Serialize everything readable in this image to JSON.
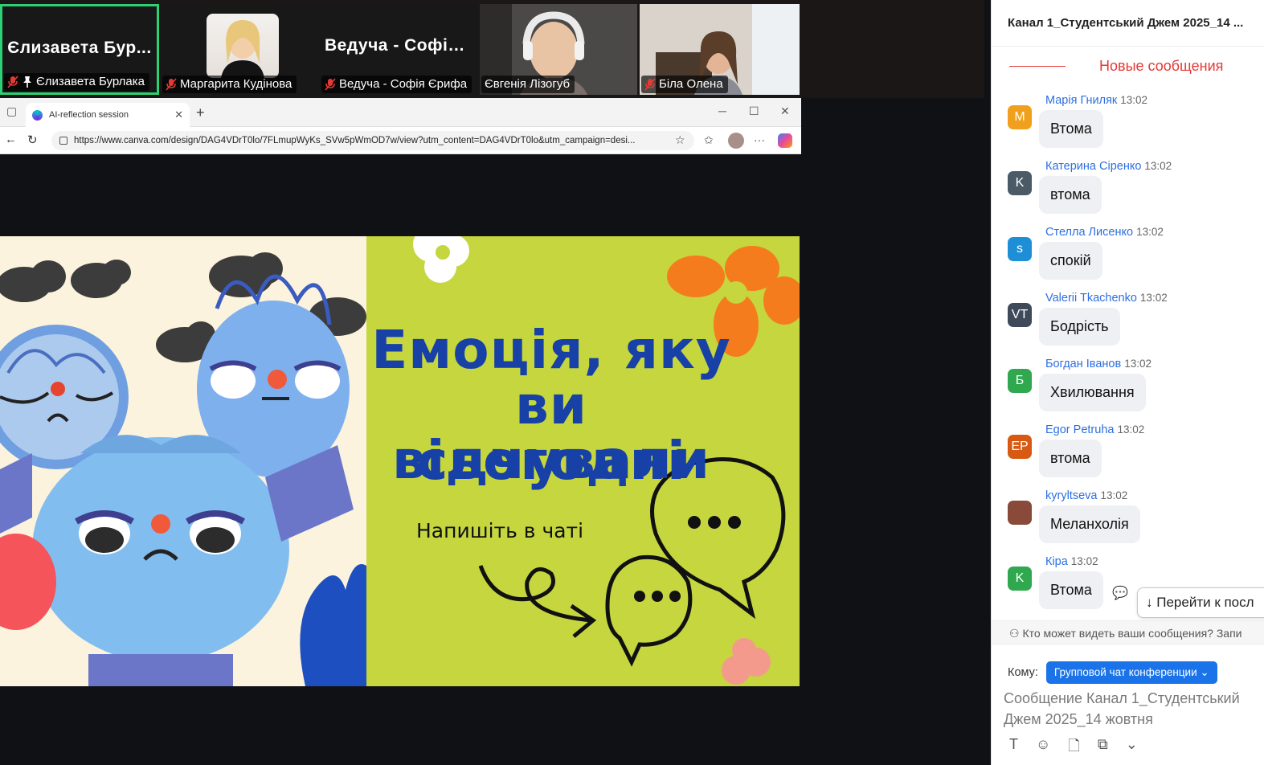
{
  "participants": [
    {
      "big_name": "Єлизавета  Бур...",
      "label": "Єлизавета Бурлака",
      "pinned": true,
      "active": true
    },
    {
      "big_name": "",
      "label": "Маргарита Кудінова",
      "has_photo": true
    },
    {
      "big_name": "Ведуча  -  Софія...",
      "label": "Ведуча - Софія Єрифа"
    },
    {
      "big_name": "",
      "label": "Євгенія Лізогуб",
      "has_video": true
    },
    {
      "big_name": "",
      "label": "Біла Олена",
      "has_video": true
    }
  ],
  "browser": {
    "tab_title": "AI-reflection session",
    "url": "https://www.canva.com/design/DAG4VDrT0lo/7FLmupWyKs_SVw5pWmOD7w/view?utm_content=DAG4VDrT0lo&utm_campaign=desi..."
  },
  "slide": {
    "title_lines": [
      "Емоція,  яку",
      "ви  відчували",
      "сьогодні"
    ],
    "subtitle": "Напишіть в чаті"
  },
  "chat": {
    "header": "Канал 1_Студентський Джем 2025_14 ...",
    "new_messages": "Новые сообщения",
    "messages": [
      {
        "initials": "M",
        "color": "#f0a01c",
        "name": "Марія Гниляк",
        "time": "13:02",
        "text": "Втома"
      },
      {
        "initials": "K",
        "color": "#4a5a66",
        "name": "Катерина Сіренко",
        "time": "13:02",
        "text": "втома"
      },
      {
        "initials": "s",
        "color": "#1e8fd6",
        "name": "Стелла Лисенко",
        "time": "13:02",
        "text": "спокій"
      },
      {
        "initials": "VT",
        "color": "#3e4a5a",
        "name": "Valerii Tkachenko",
        "time": "13:02",
        "text": "Бодрість"
      },
      {
        "initials": "Б",
        "color": "#2fa84f",
        "name": "Богдан Іванов",
        "time": "13:02",
        "text": "Хвилювання"
      },
      {
        "initials": "EP",
        "color": "#d85a12",
        "name": "Egor Petruha",
        "time": "13:02",
        "text": "втома"
      },
      {
        "initials": "",
        "color": "#8a4a3a",
        "name": "kyryltseva",
        "time": "13:02",
        "text": "Меланхолія"
      },
      {
        "initials": "K",
        "color": "#2fa84f",
        "name": "Кіра",
        "time": "13:02",
        "text": "Втома"
      }
    ],
    "jump_button": "Перейти к посл",
    "visibility_notice": "Кто может видеть ваши сообщения? Запи",
    "to_label": "Кому:",
    "to_value": "Групповой чат конференции",
    "compose_placeholder": "Сообщение Канал 1_Студентський Джем 2025_14 жовтня"
  },
  "colors": {
    "active_border": "#2ed074",
    "chat_name": "#2d6fe0",
    "new_msgs": "#e53935",
    "to_button": "#1a73e8",
    "slide_green": "#c5d63f",
    "slide_cream": "#fbf3dd",
    "slide_title": "#1741a6"
  }
}
